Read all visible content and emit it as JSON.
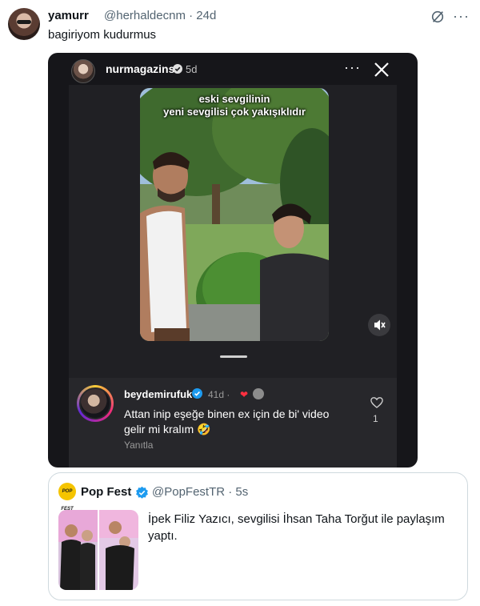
{
  "tweet": {
    "author_name": "yamurr",
    "author_handle": "@herhaldecnm",
    "time": "· 24d",
    "text": "bagiriyom kudurmus"
  },
  "story": {
    "username": "nurmagazins",
    "time": "5d",
    "caption_line1": "eski sevgilinin",
    "caption_line2": "yeni sevgilisi çok yakışıklıdır"
  },
  "comment": {
    "username": "beydemirufuk",
    "time": "41d ·",
    "text": "Attan inip eşeğe binen ex için de bi' video gelir mi kralım 🤣",
    "reply_label": "Yanıtla",
    "like_count": "1"
  },
  "quote": {
    "logo_text": "POP FEST",
    "name": "Pop Fest",
    "handle": "@PopFestTR · 5s",
    "text": "İpek Filiz Yazıcı, sevgilisi İhsan Taha Torğut ile paylaşım yaptı."
  },
  "colors": {
    "verified_blue": "#1d9bf0",
    "story_bg": "#16161a",
    "comment_bg": "#27272b",
    "heart_red": "#ff3040"
  }
}
